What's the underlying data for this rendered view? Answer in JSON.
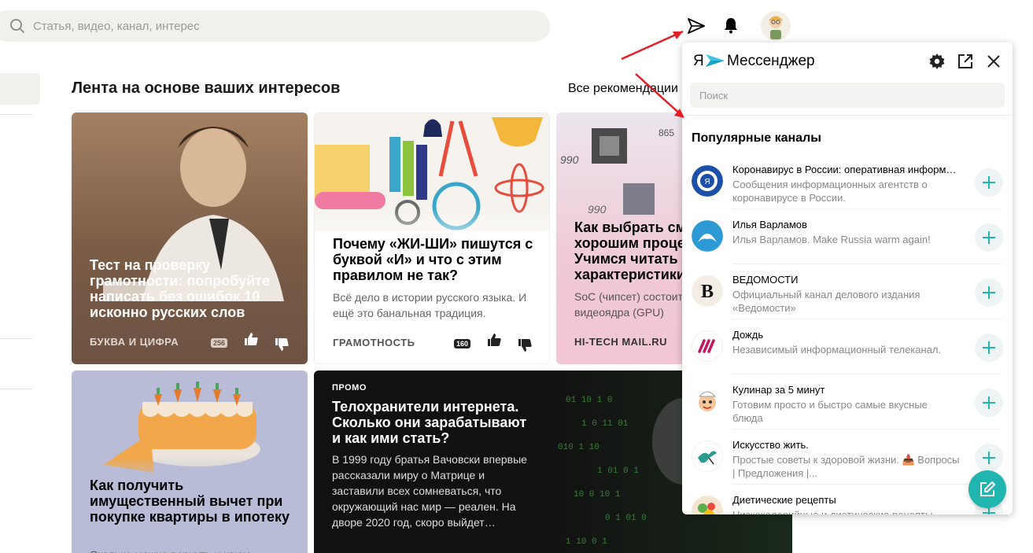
{
  "search": {
    "placeholder": "Статья, видео, канал, интерес"
  },
  "feed": {
    "title": "Лента на основе ваших интересов",
    "all_recommendations": "Все рекомендации"
  },
  "cards": [
    {
      "title": "Тест на проверку грамотности: попробуйте написать без ошибок 10 исконно русских слов",
      "source": "БУКВА И ЦИФРА",
      "count": "256"
    },
    {
      "title": "Почему «ЖИ-ШИ» пишутся с буквой «И» и что с этим правилом не так?",
      "description": "Всё дело в истории русского языка. И ещё это банальная традиция.",
      "source": "ГРАМОТНОСТЬ",
      "count": "160"
    },
    {
      "title": "Как выбрать смартфон с хорошим процессором. Учимся читать характеристики",
      "description": "SoC (чипсет) состоит из ЦП (CPU), видеоядра (GPU)",
      "source": "HI-TECH MAIL.RU"
    },
    {
      "title": "Как получить имущественный вычет при покупке квартиры в ипотеку",
      "description": "Сколько можно вернуть и какие"
    },
    {
      "badge": "ПРОМО",
      "title": "Телохранители интернета. Сколько они зарабатывают и как ими стать?",
      "description": "В 1999 году братья Вачовски впервые рассказали миру о Матрице и заставили всех сомневаться, что окружающий нас мир — реален. На дворе 2020 год, скоро выйдет…"
    }
  ],
  "messenger": {
    "logo_ya": "Я",
    "logo_text": "Мессенджер",
    "search_placeholder": "Поиск",
    "section_title": "Популярные каналы",
    "channels": [
      {
        "name": "Коронавирус в России: оперативная информация",
        "description": "Сообщения информационных агентств о коронавирусе в России."
      },
      {
        "name": "Илья Варламов",
        "description": "Илья Варламов. Make Russia warm again!"
      },
      {
        "name": "ВЕДОМОСТИ",
        "description": "Официальный канал делового издания «Ведомости»"
      },
      {
        "name": "Дождь",
        "description": "Независимый информационный телеканал."
      },
      {
        "name": "Кулинар за 5 минут",
        "description": "Готовим просто и быстро самые вкусные блюда"
      },
      {
        "name": "Искусство жить.",
        "description": "Простые советы к здоровой жизни. 📥 Вопросы | Предложения |..."
      },
      {
        "name": "Диетические рецепты",
        "description": "Низкокалорийные и диетические рецепты"
      }
    ]
  },
  "colors": {
    "accent": "#21b5b0",
    "annotation_arrow": "#e31e24"
  }
}
